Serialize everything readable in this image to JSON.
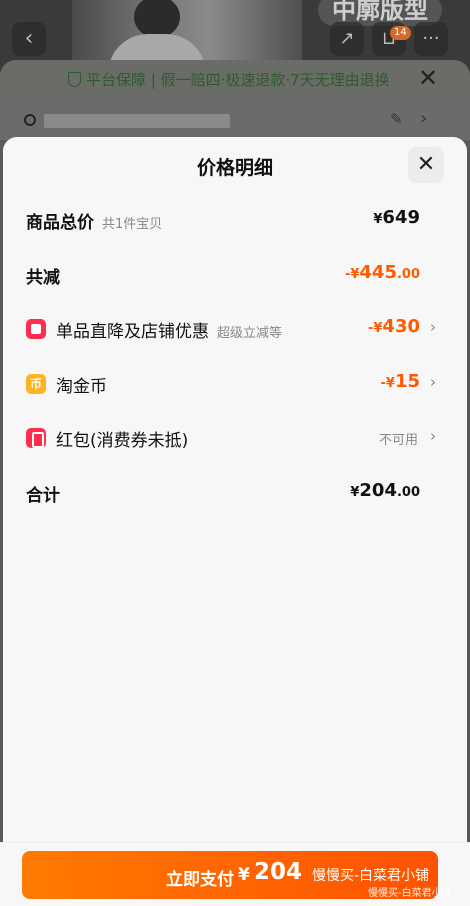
{
  "background": {
    "product_badge": "中廓版型",
    "cart_count": "14",
    "guarantee_text": "平台保障 | 假一赔四·极速退款·7天无理由退换"
  },
  "sheet": {
    "title": "价格明细"
  },
  "rows": {
    "total": {
      "label": "商品总价",
      "sub": "共1件宝贝",
      "yen": "¥",
      "value": "649"
    },
    "reduction": {
      "label": "共减",
      "prefix": "-¥",
      "value": "445",
      "decimal": ".00"
    },
    "discount": {
      "label": "单品直降及店铺优惠",
      "sub": "超级立减等",
      "prefix": "-¥",
      "value": "430"
    },
    "coins": {
      "label": "淘金币",
      "icon_text": "币",
      "prefix": "-¥",
      "value": "15"
    },
    "redpacket": {
      "label": "红包(消费券未抵)",
      "status": "不可用"
    },
    "sum": {
      "label": "合计",
      "yen": "¥",
      "value": "204",
      "decimal": ".00"
    }
  },
  "pay": {
    "label": "立即支付",
    "yen": "¥",
    "amount": "204"
  },
  "watermark": {
    "line1": "慢慢买-白菜君小铺",
    "line2": "慢慢买-白菜君小铺"
  },
  "colors": {
    "accent": "#ff5a00",
    "pay_button": "#ff6a00",
    "coupon_icon": "#ff2e4f",
    "coin_icon": "#ffb320"
  },
  "icons": [
    "back-arrow-icon",
    "share-icon",
    "cart-icon",
    "more-icon",
    "shield-icon",
    "close-icon",
    "location-icon",
    "edit-icon",
    "chevron-right-icon",
    "shop-discount-icon",
    "coin-icon",
    "red-packet-icon"
  ]
}
